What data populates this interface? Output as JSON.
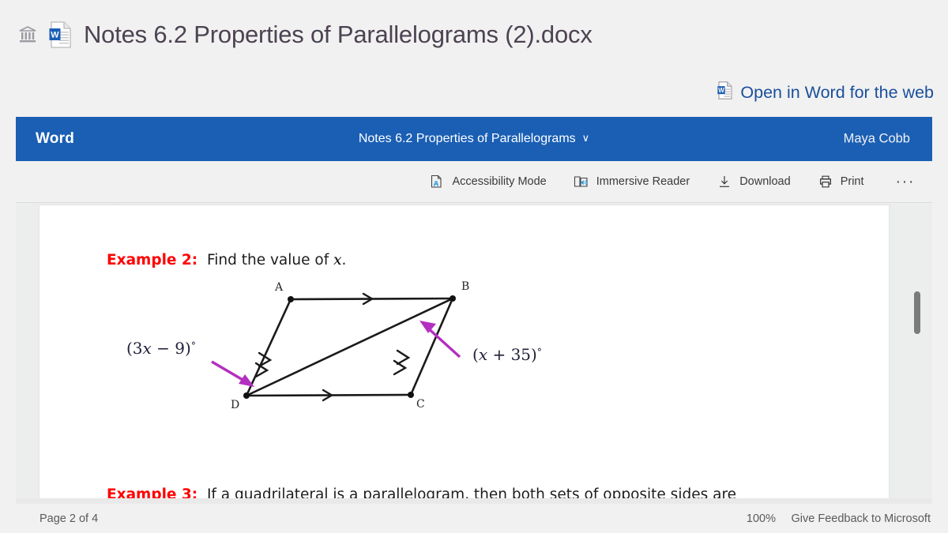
{
  "window": {
    "bank_icon": "museum-bank-icon",
    "file_icon": "word-document-icon",
    "file_title": "Notes 6.2 Properties of Parallelograms (2).docx"
  },
  "open_link": {
    "icon": "word-document-icon",
    "label": "Open in Word for the web"
  },
  "appbar": {
    "brand": "Word",
    "document_title": "Notes 6.2 Properties of Parallelograms",
    "chevron": "∨",
    "user": "Maya Cobb",
    "background_color": "#1a5fb4"
  },
  "toolbar": {
    "items": [
      {
        "label": "Accessibility Mode",
        "icon": "accessibility-mode-icon"
      },
      {
        "label": "Immersive Reader",
        "icon": "immersive-reader-icon"
      },
      {
        "label": "Download",
        "icon": "download-icon"
      },
      {
        "label": "Print",
        "icon": "print-icon"
      }
    ],
    "overflow": "···"
  },
  "document": {
    "example2": {
      "tag": "Example 2:",
      "text_before": "Find the value of ",
      "variable": "x",
      "text_after": "."
    },
    "example3": {
      "tag": "Example 3:",
      "text": "If a quadrilateral is a parallelogram, then both sets of opposite sides are"
    },
    "figure": {
      "name": "parallelogram-diagram",
      "vertex_labels": [
        "A",
        "B",
        "C",
        "D"
      ],
      "angle_label_left_parts": {
        "open": "(3",
        "var1": "x",
        "op": " − 9)",
        "deg": "°"
      },
      "angle_label_right_parts": {
        "open": "(",
        "var1": "x",
        "op": " + 35)",
        "deg": "°"
      },
      "angle_label_left": "(3x − 9)°",
      "angle_label_right": "(x + 35)°",
      "annotation_arrow_color": "#b42fc0",
      "stroke_color": "#1a1a1a"
    }
  },
  "statusbar": {
    "page": "Page 2 of 4",
    "zoom": "100%",
    "feedback": "Give Feedback to Microsoft"
  }
}
